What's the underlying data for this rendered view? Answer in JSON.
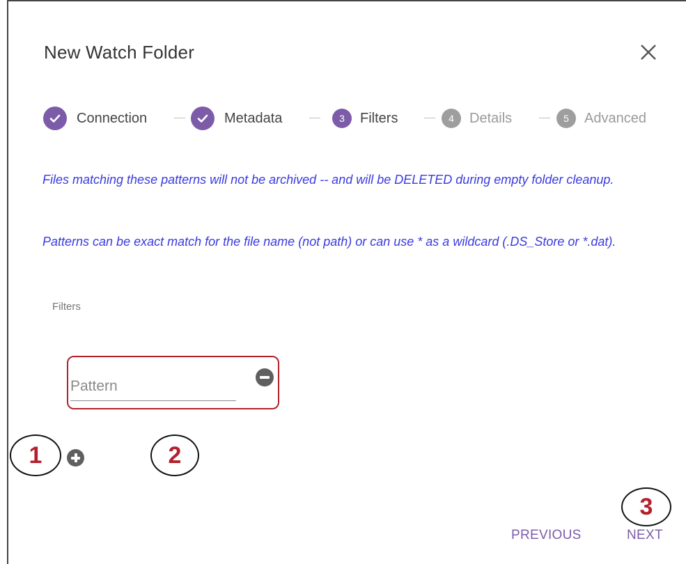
{
  "dialog": {
    "title": "New Watch Folder",
    "close_icon": "close-icon"
  },
  "stepper": {
    "steps": [
      {
        "label": "Connection",
        "state": "completed",
        "icon": "check-icon"
      },
      {
        "label": "Metadata",
        "state": "completed",
        "icon": "check-icon"
      },
      {
        "number": "3",
        "label": "Filters",
        "state": "active"
      },
      {
        "number": "4",
        "label": "Details",
        "state": "inactive"
      },
      {
        "number": "5",
        "label": "Advanced",
        "state": "inactive"
      }
    ]
  },
  "info": {
    "line1": "Files matching these patterns will not be archived -- and will be DELETED during empty folder cleanup.",
    "line2": "Patterns can be exact match for the file name (not path) or can use * as a wildcard (.DS_Store or *.dat)."
  },
  "filters": {
    "label": "Filters",
    "pattern_placeholder": "Pattern",
    "pattern_value": "",
    "remove_icon": "minus-circle-icon",
    "add_icon": "plus-circle-icon"
  },
  "callouts": [
    "1",
    "2",
    "3"
  ],
  "footer": {
    "previous_label": "PREVIOUS",
    "next_label": "NEXT"
  },
  "colors": {
    "accent": "#7c5ca8",
    "info_text": "#3a3ae0",
    "highlight": "#b3202c",
    "inactive_step": "#9e9e9e"
  }
}
